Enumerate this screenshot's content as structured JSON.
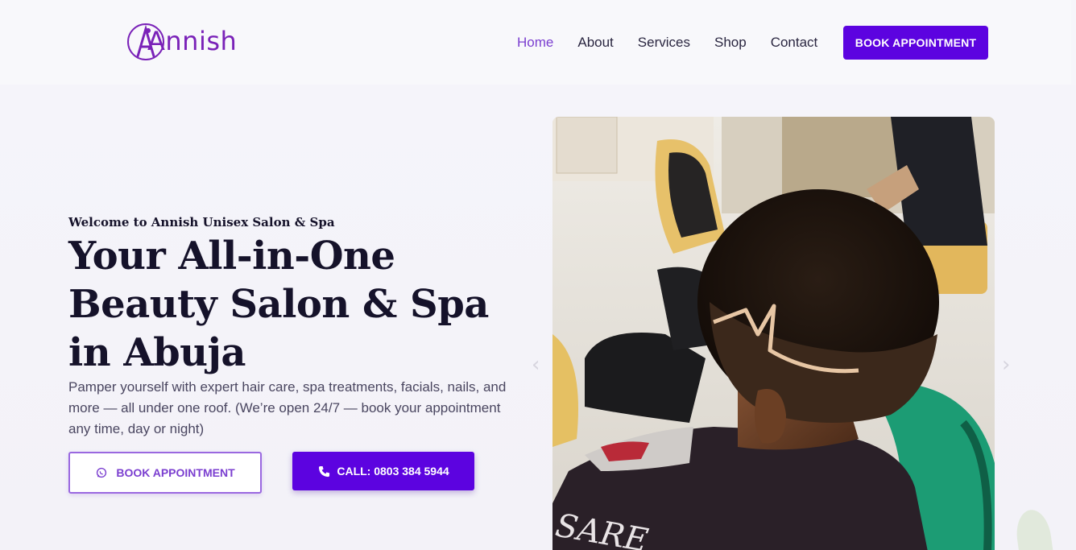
{
  "brand": {
    "name": "Annish"
  },
  "nav": {
    "items": [
      "Home",
      "About",
      "Services",
      "Shop",
      "Contact"
    ],
    "active": "Home",
    "cta": "BOOK APPOINTMENT"
  },
  "hero": {
    "eyebrow": "Welcome to Annish Unisex Salon & Spa",
    "headline": "Your All-in-One Beauty Salon & Spa in Abuja",
    "lede": "Pamper yourself with expert hair care, spa treatments, facials, nails, and more — all under one roof. (We’re open 24/7 — book your appointment any time, day or night)",
    "btn_book": "BOOK APPOINTMENT",
    "btn_call": "CALL: 0803 384 5944",
    "photo_caption_text": "SARE"
  },
  "icons": {
    "book": "whatsapp-icon",
    "call": "phone-icon",
    "prev": "chevron-left-icon",
    "next": "chevron-right-icon"
  },
  "colors": {
    "accent": "#5c03e0",
    "accent_light": "#7b3fd0",
    "brand": "#7a22b8"
  }
}
